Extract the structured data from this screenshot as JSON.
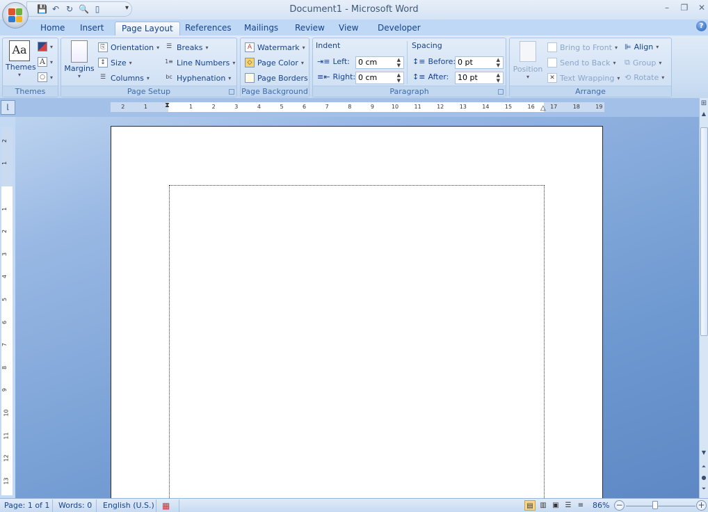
{
  "window": {
    "title": "Document1 - Microsoft Word",
    "controls": [
      "minimize",
      "restore",
      "close"
    ]
  },
  "quick_access": [
    {
      "icon": "save-icon"
    },
    {
      "icon": "undo-icon"
    },
    {
      "icon": "redo-icon"
    },
    {
      "icon": "print-preview-icon"
    },
    {
      "icon": "new-document-icon"
    }
  ],
  "tabs": [
    "Home",
    "Insert",
    "Page Layout",
    "References",
    "Mailings",
    "Review",
    "View",
    "Developer"
  ],
  "active_tab": "Page Layout",
  "ribbon": {
    "themes": {
      "label": "Themes",
      "big": "Themes"
    },
    "page_setup": {
      "label": "Page Setup",
      "margins": "Margins",
      "orientation": "Orientation",
      "size": "Size",
      "columns": "Columns",
      "breaks": "Breaks",
      "line_numbers": "Line Numbers",
      "hyphenation": "Hyphenation"
    },
    "page_background": {
      "label": "Page Background",
      "watermark": "Watermark",
      "page_color": "Page Color",
      "page_borders": "Page Borders"
    },
    "paragraph": {
      "label": "Paragraph",
      "indent": "Indent",
      "spacing": "Spacing",
      "left_label": "Left:",
      "left_value": "0 cm",
      "right_label": "Right:",
      "right_value": "0 cm",
      "before_label": "Before:",
      "before_value": "0 pt",
      "after_label": "After:",
      "after_value": "10 pt"
    },
    "arrange": {
      "label": "Arrange",
      "position": "Position",
      "bring_to_front": "Bring to Front",
      "send_to_back": "Send to Back",
      "text_wrapping": "Text Wrapping",
      "align": "Align",
      "group": "Group",
      "rotate": "Rotate"
    }
  },
  "ruler": {
    "h_left": [
      "2",
      "1"
    ],
    "h_main": [
      "1",
      "2",
      "3",
      "4",
      "5",
      "6",
      "7",
      "8",
      "9",
      "10",
      "11",
      "12",
      "13",
      "14",
      "15",
      "16",
      "17",
      "18",
      "19"
    ],
    "v_top": [
      "2",
      "1"
    ],
    "v_main": [
      "1",
      "2",
      "3",
      "4",
      "5",
      "6",
      "7",
      "8",
      "9",
      "10",
      "11",
      "12",
      "13"
    ]
  },
  "status": {
    "page": "Page: 1 of 1",
    "words": "Words: 0",
    "language": "English (U.S.)",
    "zoom": "86%",
    "zoom_level_percent": 86
  }
}
